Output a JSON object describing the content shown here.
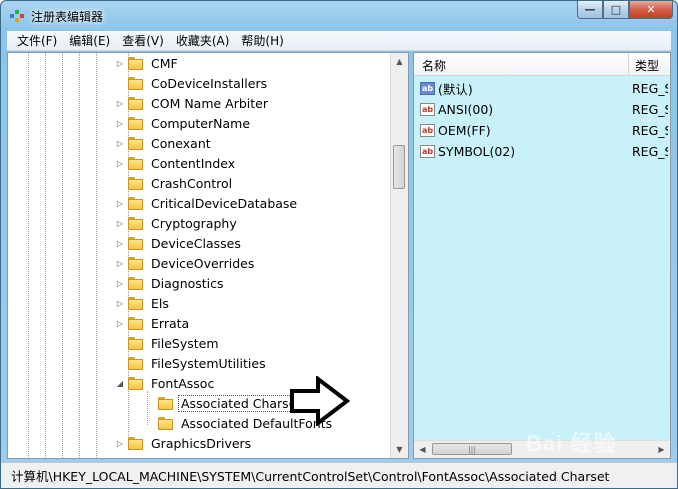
{
  "window": {
    "title": "注册表编辑器",
    "controls": {
      "minimize": "▭",
      "maximize": "□",
      "close": "✕"
    }
  },
  "menu": [
    {
      "label": "文件(F)"
    },
    {
      "label": "编辑(E)"
    },
    {
      "label": "查看(V)"
    },
    {
      "label": "收藏夹(A)"
    },
    {
      "label": "帮助(H)"
    }
  ],
  "tree": {
    "items": [
      {
        "label": "CMF",
        "expander": "▷"
      },
      {
        "label": "CoDeviceInstallers",
        "expander": ""
      },
      {
        "label": "COM Name Arbiter",
        "expander": "▷"
      },
      {
        "label": "ComputerName",
        "expander": "▷"
      },
      {
        "label": "Conexant",
        "expander": "▷"
      },
      {
        "label": "ContentIndex",
        "expander": "▷"
      },
      {
        "label": "CrashControl",
        "expander": ""
      },
      {
        "label": "CriticalDeviceDatabase",
        "expander": "▷"
      },
      {
        "label": "Cryptography",
        "expander": "▷"
      },
      {
        "label": "DeviceClasses",
        "expander": "▷"
      },
      {
        "label": "DeviceOverrides",
        "expander": "▷"
      },
      {
        "label": "Diagnostics",
        "expander": "▷"
      },
      {
        "label": "Els",
        "expander": "▷"
      },
      {
        "label": "Errata",
        "expander": "▷"
      },
      {
        "label": "FileSystem",
        "expander": ""
      },
      {
        "label": "FileSystemUtilities",
        "expander": ""
      },
      {
        "label": "FontAssoc",
        "expander": "◢"
      },
      {
        "label": "Associated Charset",
        "expander": "",
        "selected": true
      },
      {
        "label": "Associated DefaultFonts",
        "expander": ""
      },
      {
        "label": "GraphicsDrivers",
        "expander": "▷"
      }
    ]
  },
  "list": {
    "headers": {
      "name": "名称",
      "type": "类型"
    },
    "rows": [
      {
        "icon": "ab",
        "kind": "string-value-icon",
        "name": "(默认)",
        "type": "REG_SZ"
      },
      {
        "icon": "ab",
        "kind": "string-value-icon",
        "name": "ANSI(00)",
        "type": "REG_SZ"
      },
      {
        "icon": "ab",
        "kind": "string-value-icon",
        "name": "OEM(FF)",
        "type": "REG_SZ"
      },
      {
        "icon": "ab",
        "kind": "string-value-icon",
        "name": "SYMBOL(02)",
        "type": "REG_SZ"
      }
    ]
  },
  "status": {
    "path": "计算机\\HKEY_LOCAL_MACHINE\\SYSTEM\\CurrentControlSet\\Control\\FontAssoc\\Associated Charset"
  },
  "watermark": {
    "text": "Bai 经验"
  },
  "colors": {
    "list_background": "#c8f1fa",
    "window_frame": "#9fcdea"
  }
}
